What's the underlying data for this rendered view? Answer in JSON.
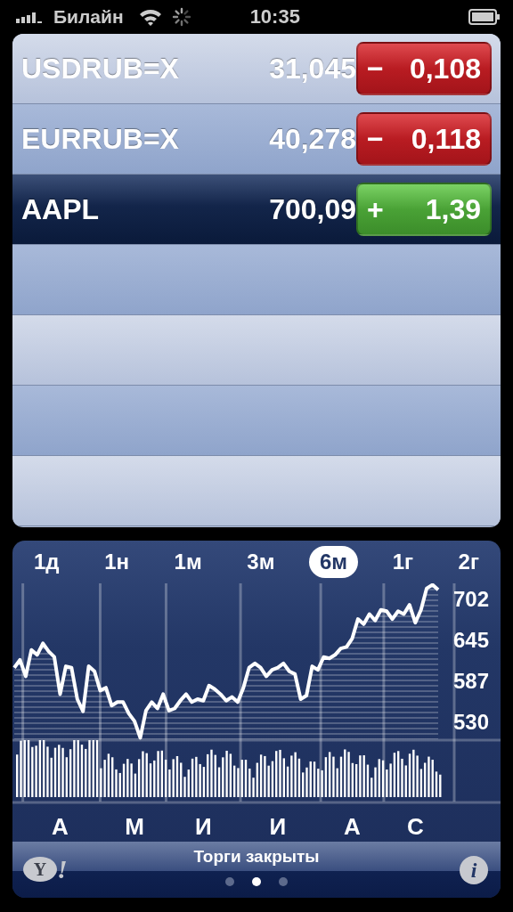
{
  "status_bar": {
    "carrier": "Билайн",
    "time": "10:35"
  },
  "stocks": [
    {
      "symbol": "USDRUB=X",
      "price": "31,045",
      "change_sign": "−",
      "change": "0,108",
      "kind": "down",
      "selected": false
    },
    {
      "symbol": "EURRUB=X",
      "price": "40,278",
      "change_sign": "−",
      "change": "0,118",
      "kind": "down",
      "selected": false
    },
    {
      "symbol": "AAPL",
      "price": "700,09",
      "change_sign": "+",
      "change": "1,39",
      "kind": "up",
      "selected": true
    }
  ],
  "ranges": [
    {
      "label": "1д",
      "selected": false
    },
    {
      "label": "1н",
      "selected": false
    },
    {
      "label": "1м",
      "selected": false
    },
    {
      "label": "3м",
      "selected": false
    },
    {
      "label": "6м",
      "selected": true
    },
    {
      "label": "1г",
      "selected": false
    },
    {
      "label": "2г",
      "selected": false
    }
  ],
  "chart_data": {
    "type": "area",
    "categories": [
      null,
      null,
      null,
      null,
      null,
      null,
      null,
      null,
      "А",
      null,
      null,
      null,
      null,
      null,
      null,
      null,
      null,
      null,
      null,
      null,
      null,
      "М",
      null,
      null,
      null,
      null,
      null,
      null,
      null,
      null,
      null,
      null,
      null,
      "И",
      null,
      null,
      null,
      null,
      null,
      null,
      null,
      null,
      null,
      null,
      null,
      null,
      "И",
      null,
      null,
      null,
      null,
      null,
      null,
      null,
      null,
      null,
      null,
      null,
      null,
      "А",
      null,
      null,
      null,
      null,
      null,
      null,
      null,
      null,
      null,
      null,
      "С",
      null,
      null,
      null,
      null
    ],
    "values": [
      605,
      616,
      593,
      630,
      623,
      639,
      628,
      620,
      568,
      607,
      605,
      561,
      544,
      607,
      600,
      573,
      577,
      552,
      557,
      557,
      541,
      530,
      507,
      545,
      557,
      548,
      568,
      545,
      548,
      559,
      568,
      557,
      561,
      559,
      580,
      575,
      568,
      559,
      564,
      557,
      577,
      605,
      611,
      605,
      593,
      602,
      605,
      611,
      600,
      596,
      561,
      566,
      607,
      602,
      620,
      618,
      623,
      632,
      634,
      646,
      673,
      666,
      680,
      671,
      686,
      684,
      673,
      684,
      680,
      693,
      668,
      686,
      716,
      721,
      714
    ],
    "ylim": [
      505,
      723
    ],
    "yticks": [
      530,
      587,
      645,
      702
    ]
  },
  "market_status": "Торги закрыты",
  "logo": {
    "letter": "Y",
    "mark": "!"
  },
  "info_button": "i",
  "page_dots": [
    {
      "selected": false
    },
    {
      "selected": true
    },
    {
      "selected": false
    }
  ]
}
